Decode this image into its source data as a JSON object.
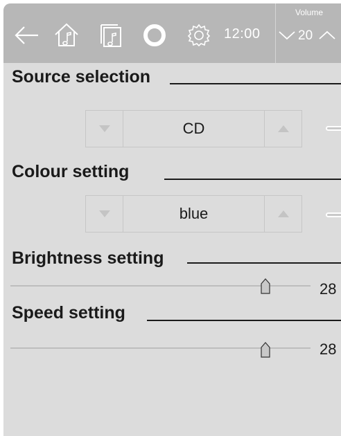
{
  "topbar": {
    "icons": [
      "back-arrow-icon",
      "home-music-icon",
      "music-library-icon",
      "voice-assistant-icon",
      "gear-icon"
    ],
    "clock": "12:00",
    "volume": {
      "label": "Volume",
      "value": "20"
    }
  },
  "source": {
    "heading": "Source selection",
    "value": "CD"
  },
  "colour": {
    "heading": "Colour setting",
    "value": "blue"
  },
  "brightness": {
    "heading": "Brightness setting",
    "value": "28",
    "level_fraction": 0.85
  },
  "speed": {
    "heading": "Speed setting",
    "value": "28",
    "level_fraction": 0.85
  },
  "colors": {
    "panel": "#dcdcdc",
    "topbar": "#b7b7b7",
    "text": "#1a1a1a",
    "icon": "#ffffff"
  }
}
